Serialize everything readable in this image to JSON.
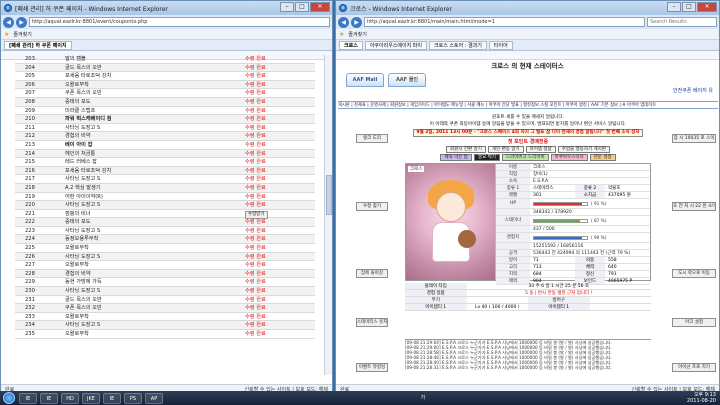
{
  "left_window": {
    "title": "[폐쇄 관리] 하 쿠폰 페이지 - Windows Internet Explorer",
    "address": "http://aqual.eazlr.kr:8801/event/couponto.php",
    "favorites_label": "즐겨찾기",
    "tab_label": "[폐쇄 관리] 하 쿠폰 페이지",
    "rows": [
      {
        "num": "203",
        "name": "말의 캠블",
        "status": "수령 완료"
      },
      {
        "num": "204",
        "name": "골드 목스의 오반",
        "status": "수령 완료"
      },
      {
        "num": "205",
        "name": "포세움 타로조덕 강치",
        "status": "수령 완료"
      },
      {
        "num": "206",
        "name": "오왈로부착",
        "status": "수령 완료"
      },
      {
        "num": "207",
        "name": "쿠폰 목스의 오빈",
        "status": "수령 완료"
      },
      {
        "num": "208",
        "name": "증테의 포도",
        "status": "수령 완료"
      },
      {
        "num": "209",
        "name": "미라클 스텝프",
        "status": "수령 완료"
      },
      {
        "num": "210",
        "name": "파워 럭스캐베이디 짐",
        "status": "수령 완료",
        "bold": true
      },
      {
        "num": "211",
        "name": "사타닝 도장고 S",
        "status": "수령 완료"
      },
      {
        "num": "212",
        "name": "경험의 비약",
        "status": "수령 완료"
      },
      {
        "num": "213",
        "name": "베이 아이 잡",
        "status": "수령 완료",
        "bold": true
      },
      {
        "num": "214",
        "name": "헤인의 처금통",
        "status": "수령 완료"
      },
      {
        "num": "215",
        "name": "레드 러베스 잡",
        "status": "수령 완료"
      },
      {
        "num": "216",
        "name": "포세움 타로조덕 강치",
        "status": "수령 완료"
      },
      {
        "num": "217",
        "name": "사타닝 도장고 S",
        "status": "수령 완료"
      },
      {
        "num": "218",
        "name": "A.2 핵심 발생기",
        "status": "수령 완료"
      },
      {
        "num": "219",
        "name": "어떤 아이이약(R)",
        "status": "수령 완료"
      },
      {
        "num": "220",
        "name": "사타닝 도장고 S",
        "status": "수령 완료"
      },
      {
        "num": "221",
        "name": "점핑의 비너",
        "status": "수령받기",
        "button": true
      },
      {
        "num": "222",
        "name": "증테의 포도",
        "status": "수령 완료"
      },
      {
        "num": "223",
        "name": "사타닝 도장고 S",
        "status": "수령 완료"
      },
      {
        "num": "224",
        "name": "동정모용투부착",
        "status": "수령 완료"
      },
      {
        "num": "225",
        "name": "오왈로부착",
        "status": "수령 완료"
      },
      {
        "num": "226",
        "name": "사타닝 도장고 S",
        "status": "수령 완료"
      },
      {
        "num": "227",
        "name": "오왈로부착",
        "status": "수령 완료"
      },
      {
        "num": "228",
        "name": "경험의 비약",
        "status": "수령 완료"
      },
      {
        "num": "229",
        "name": "동현 가방에 가득",
        "status": "수령 완료"
      },
      {
        "num": "230",
        "name": "사타닝 도장고 S",
        "status": "수령 완료"
      },
      {
        "num": "231",
        "name": "골드 목스의 오반",
        "status": "수령 완료"
      },
      {
        "num": "232",
        "name": "쿠폰 목스의 오빈",
        "status": "수령 완료"
      },
      {
        "num": "233",
        "name": "오왈로부착",
        "status": "수령 완료"
      },
      {
        "num": "234",
        "name": "사타닝 도장고 S",
        "status": "수령 완료"
      },
      {
        "num": "235",
        "name": "오왈로부착",
        "status": "수령 완료"
      }
    ],
    "status_left": "완료",
    "status_right": "신뢰할 수 있는 사이트 | 보호 모드: 해제"
  },
  "right_window": {
    "title": "크로스 - Windows Internet Explorer",
    "address": "http://aqual.eazlr.kr:8801/main/main.html/mode=1",
    "search_placeholder": "Search Results",
    "favorites_label": "즐겨찾기",
    "tabs": [
      "크로스",
      "아쿠아리우스에이지 파이",
      "크로스 스토어 : 결과기",
      "타이어"
    ],
    "page_title": "크로스 의 현재 스테이터스",
    "mall_tab": "AAF Mall",
    "mall_tab2": "AAF 몰인",
    "safety_text": "안전쿠폰 베이지 유",
    "menu_strip": "게시판 | 천재표 | 운영사제 | 회원정보 | 게임가이드 | 아이템도 매뉴얼 | 서클 메뉴 | 아쿠아 전당 발표 | 랭킹정보 스킬 포인트 | 아쿠아 랭킹 | AAF 기본 정보 | ※ 아쿠아 업데이트",
    "notice_line1": "원포트 세를 수 있을 메세지 알립니다.",
    "notice_line2": "이 아래쪽 쿠폰 최등아이템 등에 알림을 받을 수 있으며, 발표되면 받지를 일어나 편인 서비스 알림니다.",
    "notice_line3": "9월 2일, 2011 13시 00분 - \"크로스 스페이스 4회 차지 그 발표 참 다이 현재의 경험 알림니다\" 첫 번째 소식 상자",
    "event_line": "첫 포인트 경매전중",
    "side_buttons_left": [
      "랭크 도리",
      "수정 찾기",
      "집에 돌아감",
      "스테이터스 유지",
      "이벤트 뷰렁잉"
    ],
    "side_buttons_right": [
      "잠 시 10035 로 스이",
      "호 전 처 시 22 천 소이",
      "도시 학으로 이동",
      "아크 설정",
      "아이넌 프로 치기"
    ],
    "action_buttons": [
      "회원시 전환 알기",
      "개인 편동 알기",
      "아이템 정답",
      "수업을 행동하기 게시판"
    ],
    "class_buttons": [
      "캐릭 막은 밥",
      "중요 찍기",
      "드라이버크 드리이버",
      "아쿠아우스이지",
      "천운 설정"
    ],
    "char_label": "크로스",
    "stats": {
      "name_k": "이름",
      "name_v": "크로스",
      "job_k": "직업",
      "job_v": "장비(1)",
      "guild_k": "소속",
      "guild_v": "E.S.P.A",
      "rank_k": "종류 1",
      "rank_v": "스테이터스",
      "rank_k2": "종류 2",
      "rank_v2": "약물포",
      "level_k": "레벨",
      "level_v": "301",
      "level_k2": "소지금",
      "level_v2": "437095 원",
      "hp_k": "HP",
      "hp_v": "348342 / 378920",
      "hp_pct": "( 91 %)",
      "sp_k": "스태미너",
      "sp_v": "437 / 500",
      "sp_pct": "( 87 %)",
      "exp_k": "경험치",
      "exp_v": "15251592 / 16856116",
      "exp_pct": "( 90 %)",
      "atk_k": "공격",
      "atk_v": "536443 전 424994 의 111443 전 (근력 79 %)",
      "def_k": "방어",
      "def_v1": "71",
      "def_k2": "의용",
      "def_v2": "558",
      "agi_k": "고리",
      "agi_v1": "713",
      "agi_k2": "체력",
      "agi_v2": "640",
      "int_k": "지력",
      "int_v1": "684",
      "int_k2": "정신",
      "int_v2": "791",
      "luk_k": "매력",
      "luk_v1": "904",
      "luk_k2": "보인드",
      "luk_v2": "4065975 P"
    },
    "hp_fraction": 0.91,
    "sp_fraction": 0.87,
    "exp_fraction": 0.9,
    "hp_color": "#d9342b",
    "sp_color": "#6aa84f",
    "exp_color": "#2f6fd1",
    "play_time_label": "플레이 타임",
    "play_time_value": "33 주 6 일 1 시간 25 분 56 초",
    "rank_label": "경험 일람",
    "rank_value": "5 동 | 반시 한동 랭킹 근처 입니다 !",
    "bottom_row_k1": "무기",
    "bottom_row_v1": "",
    "bottom_row_k2": "방어구",
    "bottom_row_v2": "",
    "bottom_row2_k1": "아이템티 1",
    "bottom_row2_v1": "Lv 40 ( 100 / 4000 )",
    "bottom_row2_k2": "아이템티 1",
    "bottom_row2_v2": "",
    "log_lines": [
      "[09-08 21:29:04] E.S.P.A 크로스 누군가가 E.S.P.A 사냥에서 1000000 등 비밀 봉 (발 / 발) 사냥에 성공했습니다.",
      "[09-08 21:29:00] E.S.P.A 크로스 누군가가 E.S.P.A 사냥에서 1000000 등 비밀 봉 (발 / 발) 사냥에 성공했습니다.",
      "[09-08 21:28:58] E.S.P.A 크로스 누군가가 E.S.P.A 사냥에서 1000000 등 비밀 봉 (발 / 발) 사냥에 성공했습니다.",
      "[09-08 21:28:46] E.S.P.A 크로스 누군가가 E.S.P.A 사냥에서 1000000 등 비밀 봉 (발 / 발) 사냥에 성공했습니다.",
      "[09-08 21:28:40] E.S.P.A 크로스 누군가가 E.S.P.A 사냥에서 1000000 등 비밀 봉 (발 / 발) 사냥에 성공했습니다.",
      "[09-08 21:28:31] E.S.P.A 크로스 누군가가 E.S.P.A 사냥에서 1000000 등 비밀 봉 (발 / 발) 사냥에 성공했습니다."
    ],
    "status_left": "완료",
    "status_right": "신뢰할 수 있는 사이트 | 보호 모드: 해제"
  },
  "taskbar": {
    "apps": [
      "IE",
      "IE",
      "HD",
      "JKE",
      "IE",
      "PS",
      "AP"
    ],
    "tray_lang": "가",
    "clock_time": "오후 9:13",
    "clock_date": "2011-08-20"
  }
}
